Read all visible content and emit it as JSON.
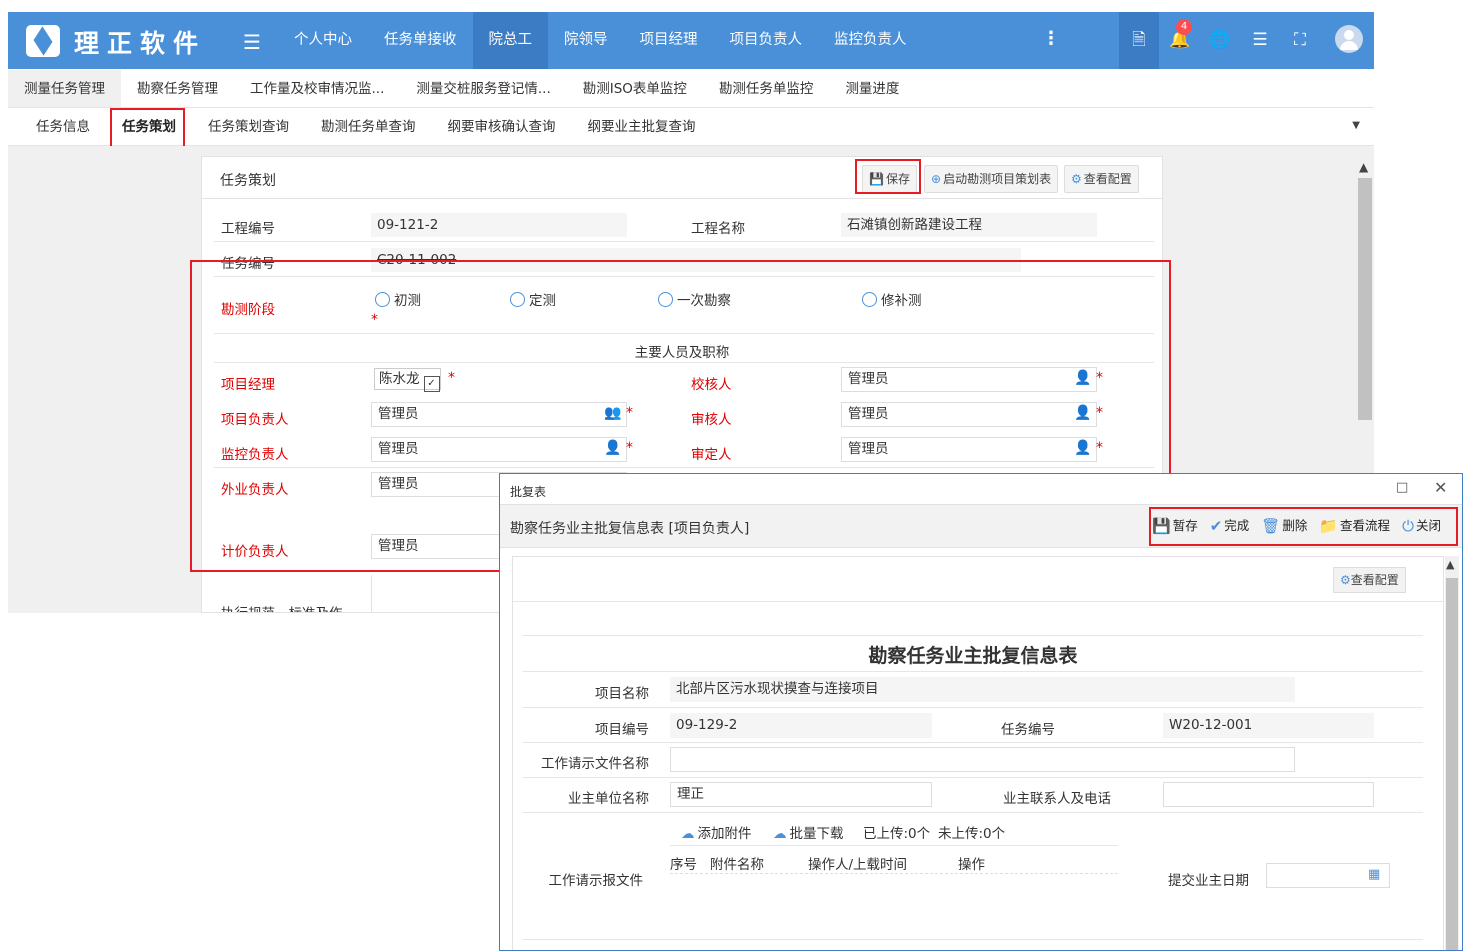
{
  "header": {
    "brand": "理正软件",
    "nav": [
      "个人中心",
      "任务单接收",
      "院总工",
      "院领导",
      "项目经理",
      "项目负责人",
      "监控负责人"
    ],
    "active_nav": "院总工",
    "notification_count": "4",
    "icons": [
      "menu-icon",
      "more-vertical-icon",
      "document-icon",
      "bell-icon",
      "globe-icon",
      "list-icon",
      "fullscreen-icon",
      "avatar-icon"
    ]
  },
  "module_tabs": [
    "测量任务管理",
    "勘察任务管理",
    "工作量及校审情况监...",
    "测量交桩服务登记情...",
    "勘测ISO表单监控",
    "勘测任务单监控",
    "测量进度"
  ],
  "sub_tabs": [
    "任务信息",
    "任务策划",
    "任务策划查询",
    "勘测任务单查询",
    "纲要审核确认查询",
    "纲要业主批复查询"
  ],
  "panel": {
    "title": "任务策划",
    "buttons": {
      "save": "保存",
      "start": "启动勘测项目策划表",
      "config": "查看配置"
    },
    "project_no_label": "工程编号",
    "project_no": "09-121-2",
    "project_name_label": "工程名称",
    "project_name": "石滩镇创新路建设工程",
    "task_no_label": "任务编号",
    "task_no": "C20-11-002",
    "stage_label": "勘测阶段",
    "stages": [
      "初测",
      "定测",
      "一次勘察",
      "修补测"
    ],
    "personnel_title": "主要人员及职称",
    "pm_label": "项目经理",
    "pm_value": "陈水龙",
    "checker_label": "校核人",
    "checker_value": "管理员",
    "lead_label": "项目负责人",
    "lead_value": "管理员",
    "reviewer_label": "审核人",
    "reviewer_value": "管理员",
    "monitor_label": "监控负责人",
    "monitor_value": "管理员",
    "approver_label": "审定人",
    "approver_value": "管理员",
    "field_label": "外业负责人",
    "field_value": "管理员",
    "pricing_label": "计价负责人",
    "pricing_value": "管理员",
    "norms_label": "执行规范、标准及作"
  },
  "dialog": {
    "window_title": "批复表",
    "heading": "勘察任务业主批复信息表 [项目负责人]",
    "buttons": {
      "temp_save": "暂存",
      "complete": "完成",
      "delete": "删除",
      "view_flow": "查看流程",
      "close": "关闭"
    },
    "config": "查看配置",
    "form_title": "勘察任务业主批复信息表",
    "project_name_label": "项目名称",
    "project_name": "北部片区污水现状摸查与连接项目",
    "project_no_label": "项目编号",
    "project_no": "09-129-2",
    "task_no_label": "任务编号",
    "task_no": "W20-12-001",
    "request_name_label": "工作请示文件名称",
    "request_name": "",
    "owner_unit_label": "业主单位名称",
    "owner_unit": "理正",
    "owner_contact_label": "业主联系人及电话",
    "owner_contact": "",
    "add_attachment": "添加附件",
    "batch_download": "批量下载",
    "uploaded": "已上传:0个",
    "not_uploaded": "未上传:0个",
    "attach_headers": [
      "序号",
      "附件名称",
      "操作人/上载时间",
      "操作"
    ],
    "report_file_label": "工作请示报文件",
    "submit_date_label": "提交业主日期",
    "submit_date": ""
  }
}
